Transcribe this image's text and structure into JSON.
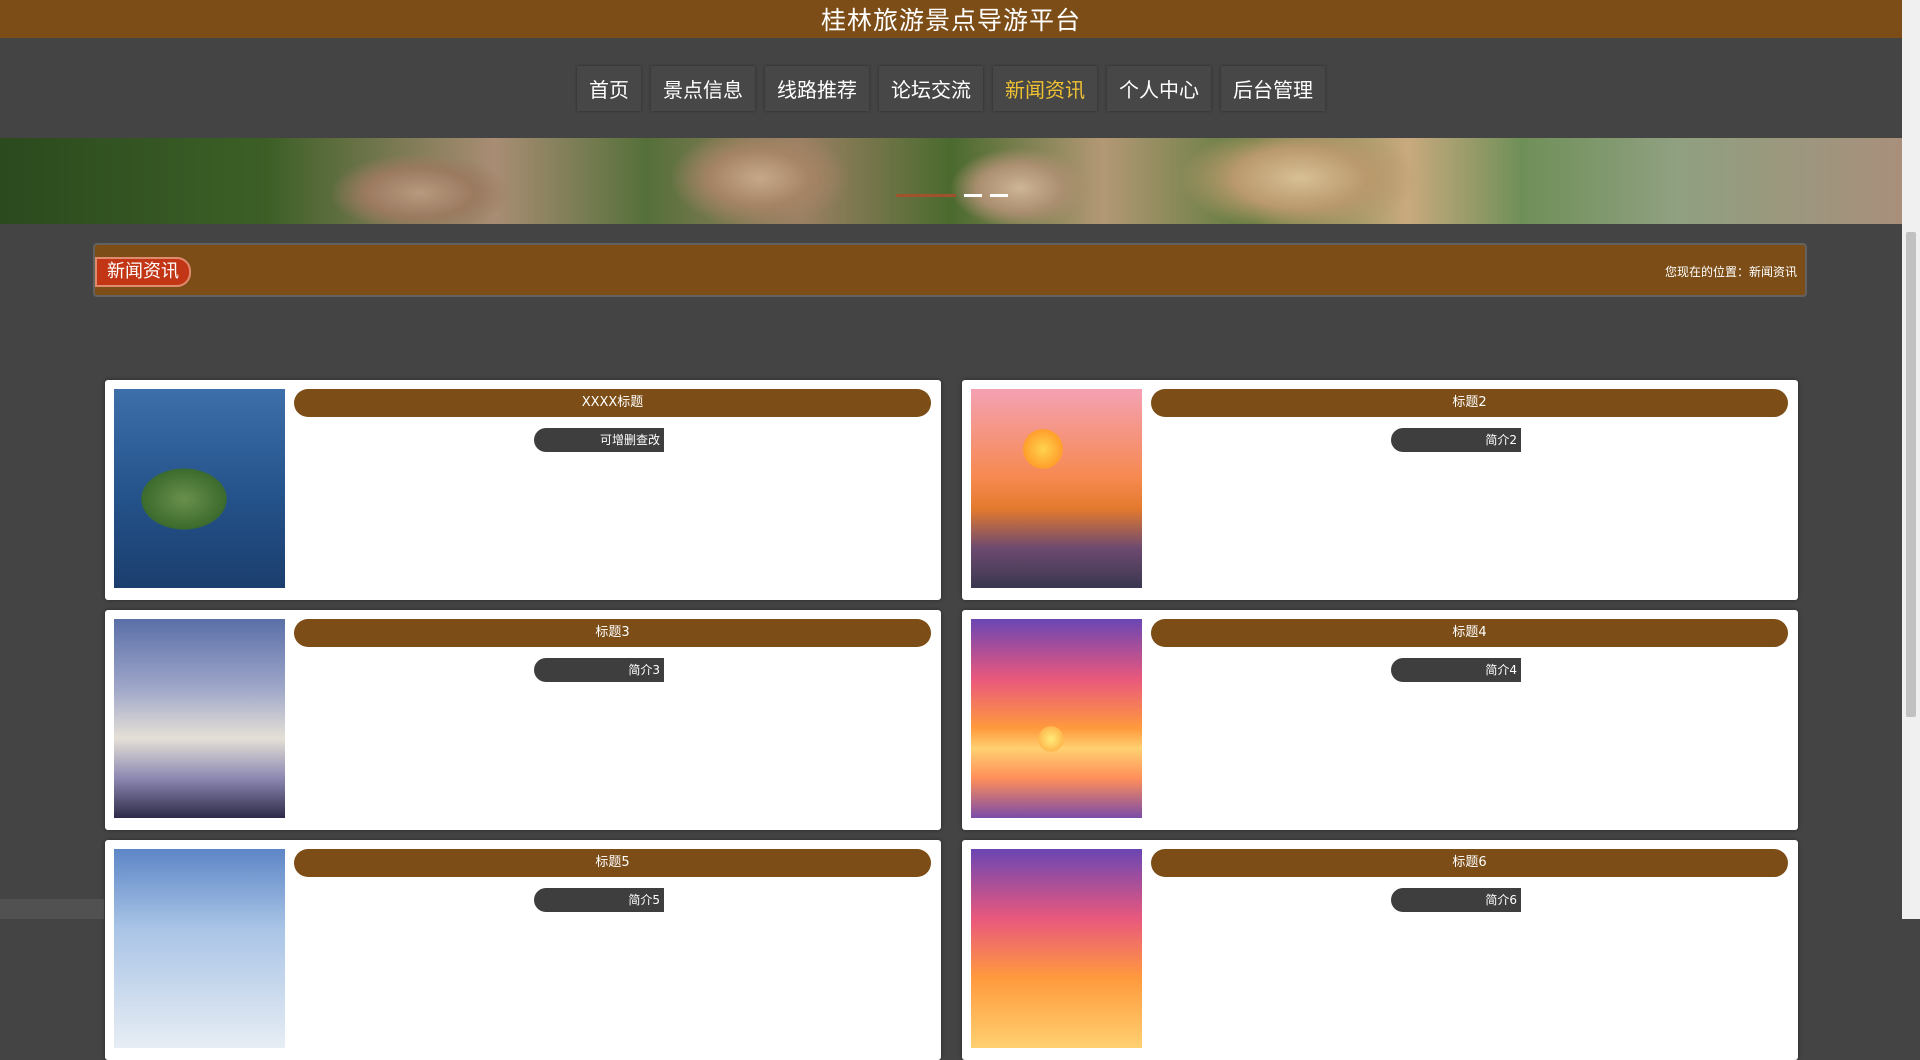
{
  "header": {
    "title": "桂林旅游景点导游平台"
  },
  "nav": {
    "items": [
      {
        "label": "首页"
      },
      {
        "label": "景点信息"
      },
      {
        "label": "线路推荐"
      },
      {
        "label": "论坛交流"
      },
      {
        "label": "新闻资讯",
        "active": true
      },
      {
        "label": "个人中心"
      },
      {
        "label": "后台管理"
      }
    ],
    "active_color": "#f1c232"
  },
  "banner": {
    "slide_count": 3,
    "active_slide": 1
  },
  "section": {
    "title": "新闻资讯",
    "breadcrumb": "您现在的位置：新闻资讯"
  },
  "news": [
    {
      "title": "XXXX标题",
      "brief": "可增删查改",
      "image": "island-aerial-image"
    },
    {
      "title": "标题2",
      "brief": "简介2",
      "image": "river-sunset-image"
    },
    {
      "title": "标题3",
      "brief": "简介3",
      "image": "sky-poster-image"
    },
    {
      "title": "标题4",
      "brief": "简介4",
      "image": "dolphin-sunset-image"
    },
    {
      "title": "标题5",
      "brief": "简介5",
      "image": "cloud-sky-image"
    },
    {
      "title": "标题6",
      "brief": "简介6",
      "image": "dolphin-sunset-image"
    }
  ],
  "colors": {
    "brand": "#7c4d16",
    "background": "#444444",
    "section_tag": "#c23616"
  }
}
